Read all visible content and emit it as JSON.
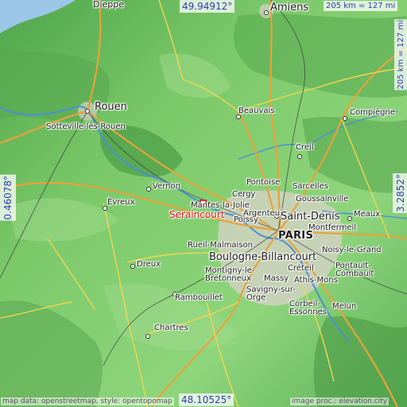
{
  "map": {
    "selected_town": "Seraincourt",
    "cities": {
      "amiens": "Amiens",
      "dieppe": "Dieppe",
      "rouen": "Rouen",
      "sotteville": "Sotteville-lès-Rouen",
      "beauvais": "Beauvais",
      "compiegne": "Compiègne",
      "creil": "Creil",
      "vernon": "Vernon",
      "evreux": "Évreux",
      "cergy": "Cergy",
      "pontoise": "Pontoise",
      "sarcelles": "Sarcelles",
      "goussainville": "Goussainville",
      "mantes": "Mantes-la-Jolie",
      "poissy": "Poissy",
      "argenteuil": "Argenteuil",
      "saint_denis": "Saint-Denis",
      "meaux": "Meaux",
      "montfermeil": "Montfermeil",
      "paris": "PARIS",
      "rueil": "Rueil-Malmaison",
      "boulogne": "Boulogne-Billancourt",
      "noisy": "Noisy-le-Grand",
      "dreux": "Dreux",
      "montigny": "Montigny-le-Bretonneux",
      "creteil": "Créteil",
      "massy": "Massy",
      "pontault": "Pontault-Combault",
      "athis": "Athis-Mons",
      "savigny": "Savigny-sur-Orge",
      "rambouillet": "Rambouillet",
      "corbeil": "Corbeil-Essonnes",
      "melun": "Melun",
      "chartres": "Chartres"
    },
    "coords": {
      "top_lat": "49.94912°",
      "bottom_lat": "48.10525°",
      "left_lon": "0.46078°",
      "right_lon": "3.2852°"
    },
    "scale": {
      "horizontal": "205 km = 127 mi",
      "vertical": "205 km = 127 mi"
    },
    "credits": {
      "left": "map data: openstreetmap, style: opentopomap",
      "right": "image proc.: elevation.city"
    },
    "colors": {
      "sea": "#9cc6e8",
      "lowland": "#8fd27c",
      "highland": "#5fae5a",
      "road_major": "#e8a23a",
      "road_minor": "#f2d64f",
      "urban": "#d8d0c8",
      "marker": "#e01010",
      "coord_text": "#2d3fb0"
    }
  }
}
